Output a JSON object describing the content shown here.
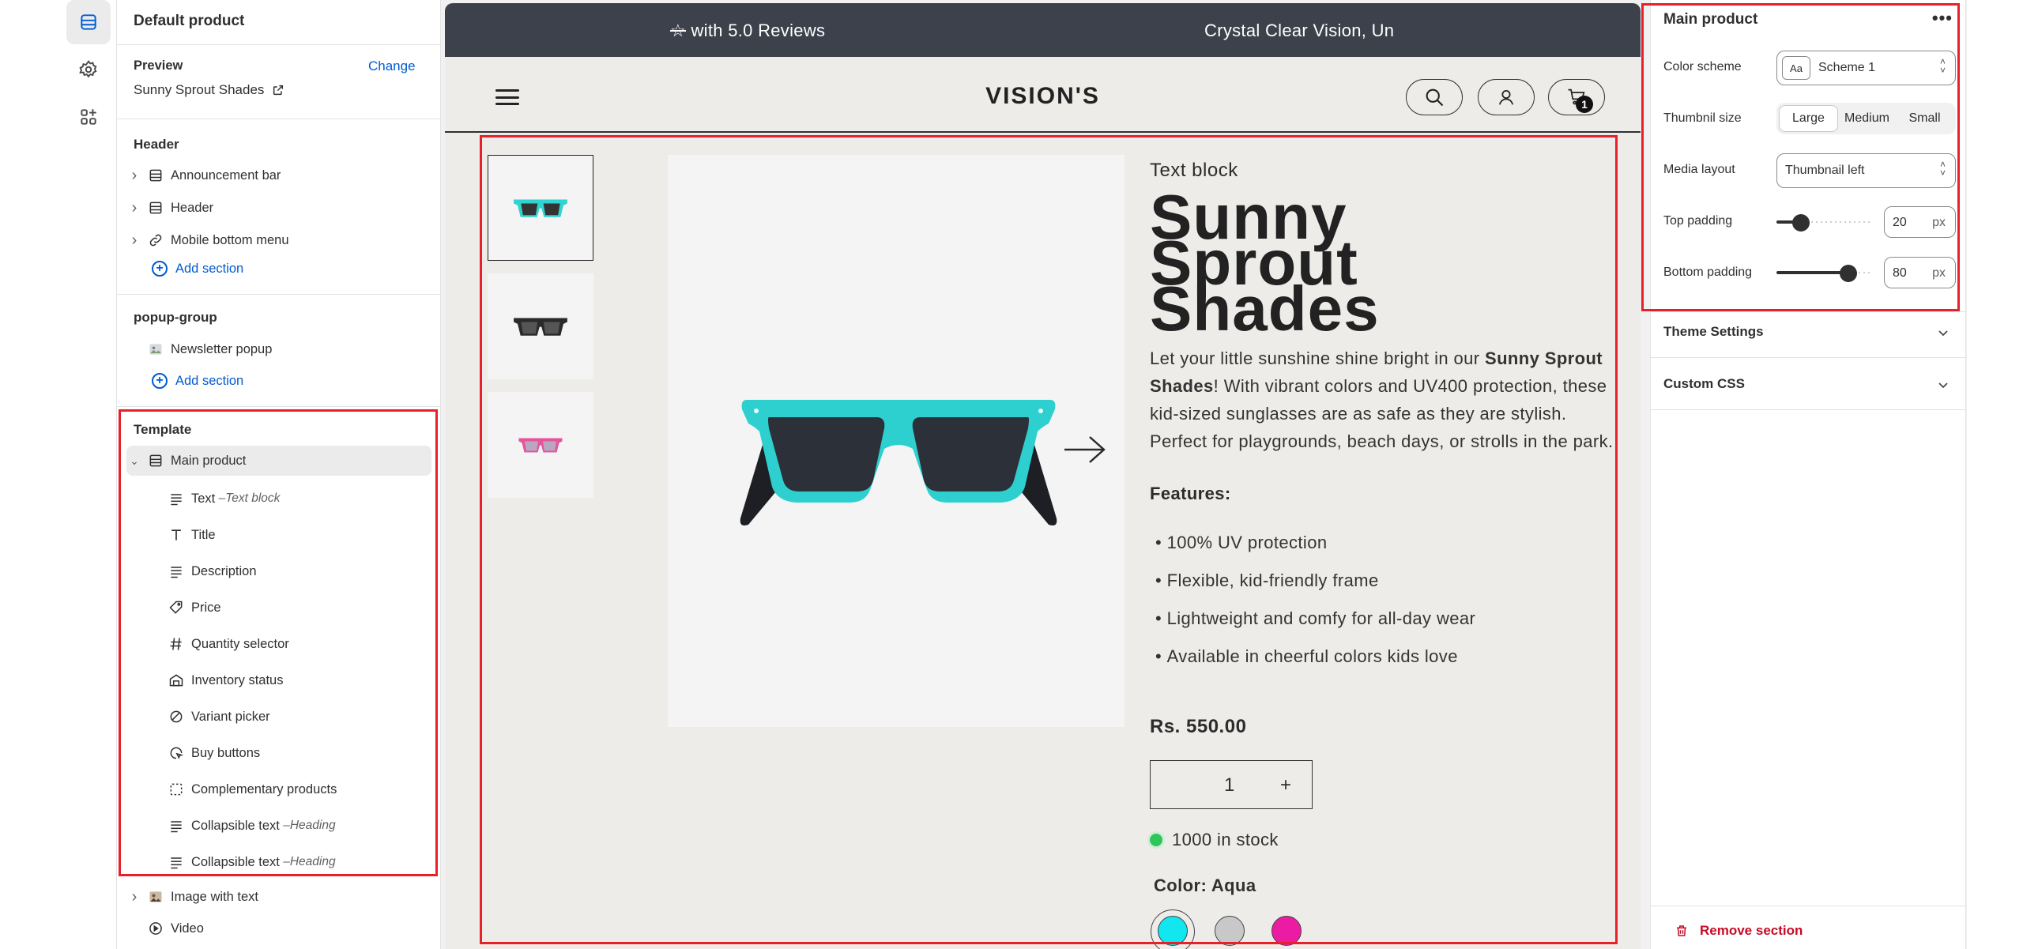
{
  "colors": {
    "accent_link": "#005bd3",
    "highlight_box": "#e8202a",
    "announcement_bg": "#3d414b",
    "canvas_bg": "#edece9",
    "danger": "#c70a24",
    "stock_dot": "#2ec55a"
  },
  "rail": {
    "items": [
      {
        "icon": "sections-icon",
        "active": true
      },
      {
        "icon": "gear-icon",
        "active": false
      },
      {
        "icon": "apps-icon",
        "active": false
      }
    ]
  },
  "sidebar": {
    "title": "Default product",
    "preview": {
      "label": "Preview",
      "change_label": "Change",
      "value": "Sunny Sprout Shades"
    },
    "header_group": {
      "label": "Header",
      "items": [
        {
          "label": "Announcement bar",
          "icon": "layout-icon"
        },
        {
          "label": "Header",
          "icon": "layout-icon"
        },
        {
          "label": "Mobile bottom menu",
          "icon": "link-icon"
        }
      ],
      "add_label": "Add section"
    },
    "popup_group": {
      "label": "popup-group",
      "items": [
        {
          "label": "Newsletter popup",
          "icon": "image-icon"
        }
      ],
      "add_label": "Add section"
    },
    "template_group": {
      "label": "Template",
      "section": {
        "label": "Main product",
        "icon": "layout-icon"
      },
      "blocks": [
        {
          "label": "Text",
          "sub": "Text block",
          "icon": "text-lines-icon"
        },
        {
          "label": "Title",
          "sub": "",
          "icon": "title-icon"
        },
        {
          "label": "Description",
          "sub": "",
          "icon": "text-lines-icon"
        },
        {
          "label": "Price",
          "sub": "",
          "icon": "price-tag-icon"
        },
        {
          "label": "Quantity selector",
          "sub": "",
          "icon": "hashtag-icon"
        },
        {
          "label": "Inventory status",
          "sub": "",
          "icon": "inventory-icon"
        },
        {
          "label": "Variant picker",
          "sub": "",
          "icon": "variant-icon"
        },
        {
          "label": "Buy buttons",
          "sub": "",
          "icon": "cursor-icon"
        },
        {
          "label": "Complementary products",
          "sub": "",
          "icon": "dashed-square-icon"
        },
        {
          "label": "Collapsible text",
          "sub": "Heading",
          "icon": "text-lines-icon"
        },
        {
          "label": "Collapsible text",
          "sub": "Heading",
          "icon": "text-lines-icon"
        }
      ],
      "after_sections": [
        {
          "label": "Image with text",
          "icon": "image-icon"
        },
        {
          "label": "Video",
          "icon": "play-icon"
        }
      ]
    }
  },
  "preview": {
    "announcement": {
      "left": "with 5.0 Reviews",
      "right": "Crystal Clear Vision, Un"
    },
    "store": {
      "logo": "VISION'S",
      "cart_count": "1"
    },
    "product": {
      "text_block": "Text block",
      "title_lines": [
        "Sunny",
        "Sprout",
        "Shades"
      ],
      "desc": {
        "p1": "Let your little sunshine shine bright in our ",
        "p1_bold": "Sunny Sprout Shades",
        "p2": "! With vibrant colors and UV400 protection, these kid-sized sunglasses are as safe as they are stylish. Perfect for playgrounds, beach days, or strolls in the park."
      },
      "features_heading": "Features:",
      "features": [
        "100% UV protection",
        "Flexible, kid-friendly frame",
        "Lightweight and comfy for all-day wear",
        "Available in cheerful colors kids love"
      ],
      "price": "Rs. 550.00",
      "quantity": "1",
      "qty_plus": "+",
      "stock": "1000 in stock",
      "color_label": "Color: Aqua",
      "swatches": [
        {
          "name": "Aqua",
          "hex": "#12e6ef",
          "selected": true
        },
        {
          "name": "Grey",
          "hex": "#c8c8c8",
          "selected": false
        },
        {
          "name": "Pink",
          "hex": "#ec1ba4",
          "selected": false
        }
      ],
      "thumb_colors": [
        "#2fd4d0",
        "#333333",
        "#e6559a"
      ]
    }
  },
  "settings": {
    "title": "Main product",
    "more": "•••",
    "color_scheme": {
      "label": "Color scheme",
      "value": "Scheme 1",
      "badge": "Aa"
    },
    "thumbnail_size": {
      "label": "Thumbnil size",
      "options": [
        "Large",
        "Medium",
        "Small"
      ],
      "selected": "Large"
    },
    "media_layout": {
      "label": "Media layout",
      "value": "Thumbnail left"
    },
    "top_padding": {
      "label": "Top padding",
      "value": "20",
      "unit": "px",
      "fraction": 0.2
    },
    "bottom_padding": {
      "label": "Bottom padding",
      "value": "80",
      "unit": "px",
      "fraction": 0.8
    },
    "theme_settings": "Theme Settings",
    "custom_css": "Custom CSS",
    "remove": "Remove section"
  }
}
